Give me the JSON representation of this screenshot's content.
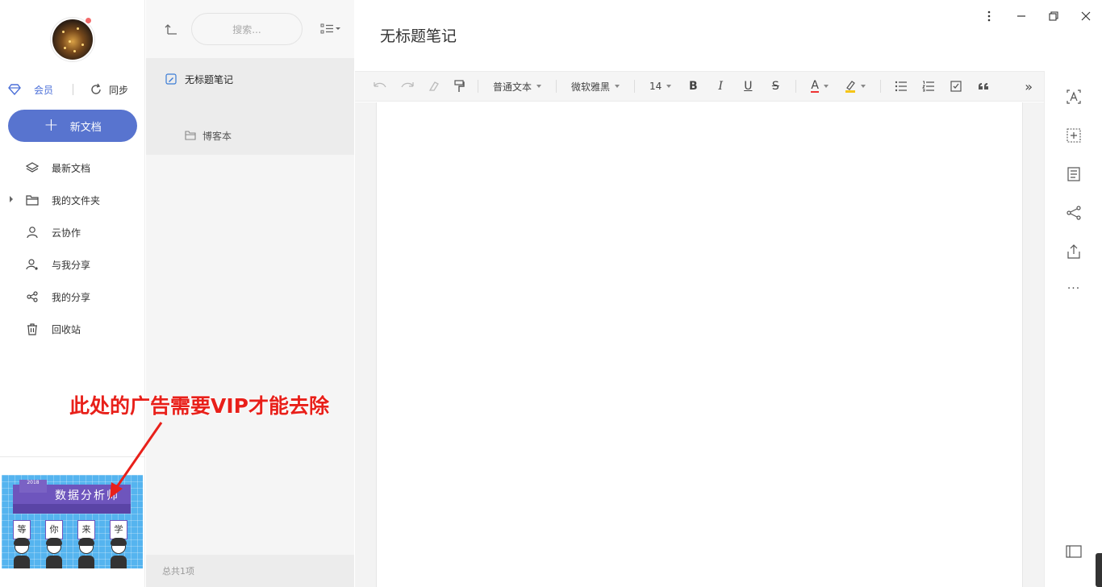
{
  "sidebar": {
    "vip_label": "会员",
    "sync_label": "同步",
    "new_doc_label": "新文档",
    "items": [
      {
        "label": "最新文档",
        "icon": "layers-icon"
      },
      {
        "label": "我的文件夹",
        "icon": "folder-icon",
        "expandable": true
      },
      {
        "label": "云协作",
        "icon": "user-icon"
      },
      {
        "label": "与我分享",
        "icon": "user-share-icon"
      },
      {
        "label": "我的分享",
        "icon": "share-icon"
      },
      {
        "label": "回收站",
        "icon": "trash-icon"
      }
    ],
    "ad": {
      "year": "2018",
      "headline": "数据分析师",
      "cards": [
        "等",
        "你",
        "来",
        "学"
      ]
    }
  },
  "list": {
    "search_placeholder": "搜索...",
    "items": [
      {
        "label": "无标题笔记",
        "icon": "note-icon"
      },
      {
        "label": "博客本",
        "icon": "notebook-icon"
      }
    ],
    "footer": "总共1项"
  },
  "editor": {
    "title": "无标题笔记",
    "toolbar": {
      "paragraph_style": "普通文本",
      "font_family": "微软雅黑",
      "font_size": "14",
      "bold": "B",
      "italic": "I",
      "underline": "U",
      "strike": "S",
      "font_color": "A",
      "more": "»"
    },
    "rail_more": "···"
  },
  "annotation": {
    "text": "此处的广告需要VIP才能去除"
  },
  "colors": {
    "accent": "#5874cf",
    "vip": "#4b6fd8",
    "annotation": "#e8201a",
    "ad_bg": "#55b4ef",
    "ad_banner": "#6e55bd"
  }
}
